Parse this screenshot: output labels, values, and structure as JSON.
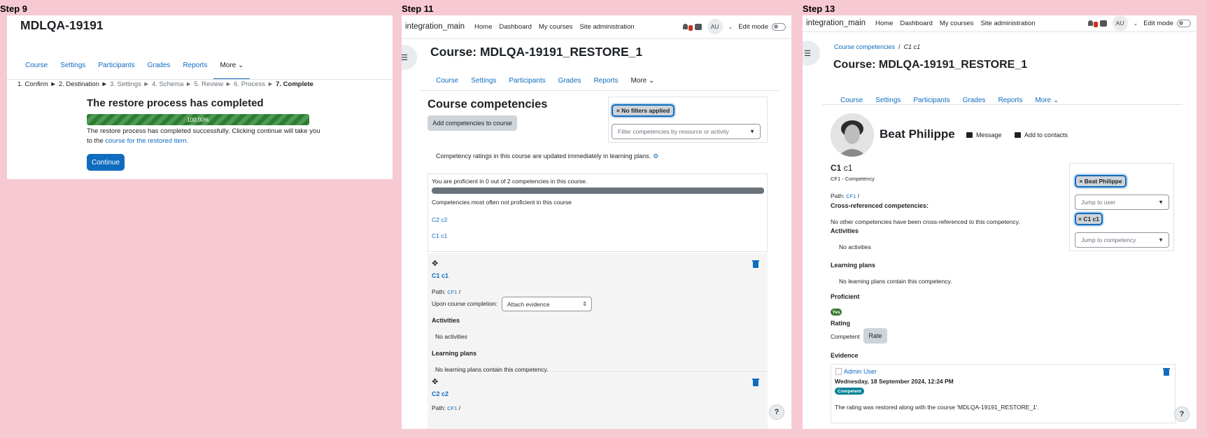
{
  "step9": {
    "step_label": "Step 9",
    "page_title": "MDLQA-19191",
    "tabs": [
      "Course",
      "Settings",
      "Participants",
      "Grades",
      "Reports",
      "More ⌄"
    ],
    "steps": [
      {
        "label": "1. Confirm ►",
        "state": "done"
      },
      {
        "label": "2. Destination ►",
        "state": "done"
      },
      {
        "label": "3. Settings ►",
        "state": "todo"
      },
      {
        "label": "4. Schema ►",
        "state": "todo"
      },
      {
        "label": "5. Review ►",
        "state": "todo"
      },
      {
        "label": "6. Process ►",
        "state": "todo"
      },
      {
        "label": "7. Complete",
        "state": "cur"
      }
    ],
    "heading": "The restore process has completed",
    "progress_label": "100.00%",
    "progress_value": 1.0,
    "message_pre": "The restore process has completed successfully. Clicking continue will take you to the ",
    "message_link": "course for the restored item.",
    "continue_label": "Continue"
  },
  "step11": {
    "step_label": "Step 11",
    "navbar": {
      "site": "integration_main",
      "links": [
        "Home",
        "Dashboard",
        "My courses",
        "Site administration"
      ],
      "avatar": "AU",
      "edit_mode": "Edit mode"
    },
    "course_title": "Course: MDLQA-19191_RESTORE_1",
    "tabs": [
      "Course",
      "Settings",
      "Participants",
      "Grades",
      "Reports",
      "More ⌄"
    ],
    "heading": "Course competencies",
    "add_button": "Add competencies to course",
    "filter_chip": "× No filters applied",
    "filter_placeholder": "Filter competencies by resource or activity",
    "rating_note": "Competency ratings in this course are updated immediately in learning plans.",
    "summary": {
      "proficient_text": "You are proficient in 0 out of 2 competencies in this course.",
      "proficient_value": 0,
      "proficient_total": 2,
      "not_proficient_heading": "Competencies most often not proficient in this course",
      "links": [
        "C2 c2",
        "C1 c1"
      ]
    },
    "cards": [
      {
        "title": "C1 c1",
        "path_label": "Path:",
        "path_link": "CF1",
        "path_sep": "/",
        "completion_label": "Upon course completion:",
        "completion_value": "Attach evidence",
        "activities_heading": "Activities",
        "activities_text": "No activities",
        "plans_heading": "Learning plans",
        "plans_text": "No learning plans contain this competency."
      },
      {
        "title": "C2 c2",
        "path_label": "Path:",
        "path_link": "CF1",
        "path_sep": "/"
      }
    ],
    "help": "?"
  },
  "step13": {
    "step_label": "Step 13",
    "navbar": {
      "site": "integration_main",
      "links": [
        "Home",
        "Dashboard",
        "My courses",
        "Site administration"
      ],
      "avatar": "AU",
      "edit_mode": "Edit mode"
    },
    "breadcrumb": [
      "Course competencies",
      "/",
      "C1 c1"
    ],
    "course_title": "Course: MDLQA-19191_RESTORE_1",
    "tabs": [
      "Course",
      "Settings",
      "Participants",
      "Grades",
      "Reports",
      "More ⌄"
    ],
    "user_name": "Beat Philippe",
    "message_link": "Message",
    "contacts_link": "Add to contacts",
    "competency_short": "C1",
    "competency_name": "c1",
    "framework": "CF1 - Competency",
    "path_label": "Path:",
    "path_link": "CF1",
    "path_sep": "/",
    "cross_heading": "Cross-referenced competencies:",
    "cross_text": "No other competencies have been cross-referenced to this competency.",
    "activities_heading": "Activities",
    "activities_text": "No activities",
    "plans_heading": "Learning plans",
    "plans_text": "No learning plans contain this competency.",
    "proficient_heading": "Proficient",
    "proficient_badge": "Yes",
    "rating_heading": "Rating",
    "rating_value": "Competent",
    "rate_button": "Rate",
    "evidence_heading": "Evidence",
    "evidence": {
      "author": "Admin User",
      "date": "Wednesday, 18 September 2024, 12:24 PM",
      "badge": "Competent",
      "note": "The rating was restored along with the course 'MDLQA-19191_RESTORE_1'."
    },
    "user_chip": "× Beat Philippe",
    "jump_user": "Jump to user",
    "comp_chip": "× C1 c1",
    "jump_comp": "Jump to competency",
    "help": "?"
  },
  "colors": {
    "background": "#f7cad3",
    "link": "#0f6cbf",
    "progress": "#2e7d32",
    "badge_yes": "#357a32",
    "badge_competent": "#008196"
  }
}
